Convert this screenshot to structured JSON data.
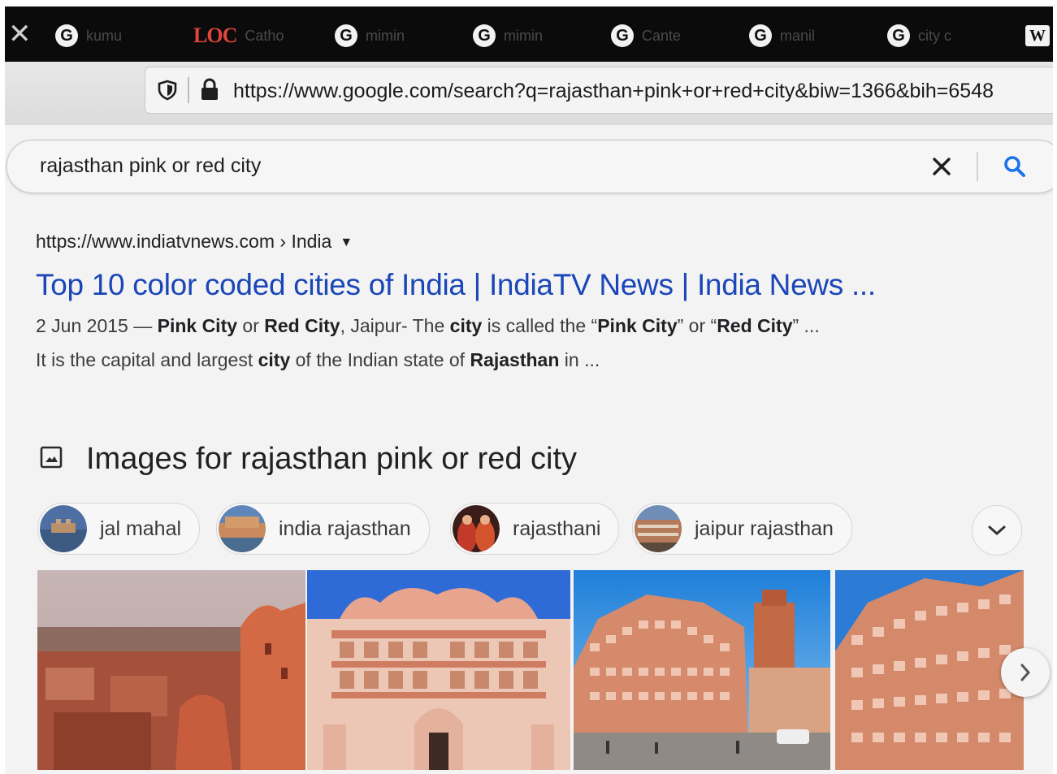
{
  "tabs": [
    {
      "icon": "google-icon",
      "glyph": "G",
      "label": "kumu"
    },
    {
      "icon": "loc-icon",
      "glyph": "LOC",
      "label": "Catho"
    },
    {
      "icon": "google-icon",
      "glyph": "G",
      "label": "mimin"
    },
    {
      "icon": "google-icon",
      "glyph": "G",
      "label": "mimin"
    },
    {
      "icon": "ganesh-icon",
      "glyph": "G",
      "label": "Cante"
    },
    {
      "icon": "google-icon",
      "glyph": "G",
      "label": "manil"
    },
    {
      "icon": "google-icon",
      "glyph": "G",
      "label": "city c"
    },
    {
      "icon": "wikipedia-icon",
      "glyph": "W",
      "label": ""
    }
  ],
  "browser": {
    "close_glyph": "✕",
    "url": "https://www.google.com/search?q=rajasthan+pink+or+red+city&biw=1366&bih=6548"
  },
  "search": {
    "query": "rajasthan pink or red city"
  },
  "result": {
    "cite": "https://www.indiatvnews.com › India",
    "title": "Top 10 color coded cities of India | IndiaTV News | India News ...",
    "snippet_line1": [
      {
        "t": "2 Jun 2015 — ",
        "b": false
      },
      {
        "t": "Pink City",
        "b": true
      },
      {
        "t": " or ",
        "b": false
      },
      {
        "t": "Red City",
        "b": true
      },
      {
        "t": ", Jaipur- The ",
        "b": false
      },
      {
        "t": "city",
        "b": true
      },
      {
        "t": " is called the “",
        "b": false
      },
      {
        "t": "Pink City",
        "b": true
      },
      {
        "t": "” or “",
        "b": false
      },
      {
        "t": "Red City",
        "b": true
      },
      {
        "t": "” ...",
        "b": false
      }
    ],
    "snippet_line2": [
      {
        "t": "It is the capital and largest ",
        "b": false
      },
      {
        "t": "city",
        "b": true
      },
      {
        "t": " of the Indian state of ",
        "b": false
      },
      {
        "t": "Rajasthan",
        "b": true
      },
      {
        "t": " in ...",
        "b": false
      }
    ]
  },
  "images": {
    "heading": "Images for rajasthan pink or red city",
    "chips": [
      "jal mahal",
      "india rajasthan",
      "rajasthani",
      "jaipur rajasthan"
    ],
    "photos": [
      "Jaipur city view with Hawa Mahal",
      "City Palace Jaipur facade",
      "Hawa Mahal street view",
      "Hawa Mahal close-up"
    ]
  },
  "colors": {
    "link_blue": "#1a46b8",
    "search_blue": "#1a73e8",
    "pink_sandstone": "#e08a6c"
  }
}
